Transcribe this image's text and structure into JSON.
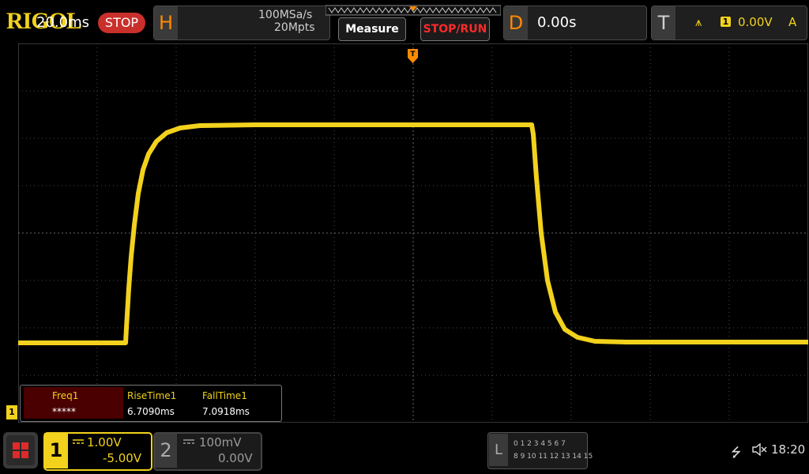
{
  "brand": {
    "logo": "RIGOL",
    "run_state": "STOP"
  },
  "horizontal": {
    "letter": "H",
    "timebase": "20.0ms",
    "sample_rate": "100MSa/s",
    "memory_depth": "20Mpts"
  },
  "buttons": {
    "measure": "Measure",
    "stop_run": "STOP/RUN"
  },
  "delay": {
    "letter": "D",
    "value": "0.00s"
  },
  "trigger": {
    "letter": "T",
    "edge_icon": "rising-edge-icon",
    "source": "1",
    "level": "0.00V",
    "mode": "A"
  },
  "measurements": {
    "freq": {
      "label": "Freq1",
      "value": "*****"
    },
    "rise": {
      "label": "RiseTime1",
      "value": "6.7090ms"
    },
    "fall": {
      "label": "FallTime1",
      "value": "7.0918ms"
    }
  },
  "channel1": {
    "number": "1",
    "scale": "1.00V",
    "offset": "-5.00V",
    "color": "#f2d21c"
  },
  "channel2": {
    "number": "2",
    "scale": "100mV",
    "offset": "0.00V",
    "color": "#9a9a9a"
  },
  "logic": {
    "letter": "L",
    "row1": "0 1 2 3  4 5 6 7",
    "row2": "8 9 10 11 12 13 14 15"
  },
  "markers": {
    "ch1_ground": "1"
  },
  "status": {
    "time": "18:20"
  },
  "colors": {
    "accent": "#ff8a00",
    "trace": "#f2d21c",
    "grid": "#5a5a5a"
  }
}
